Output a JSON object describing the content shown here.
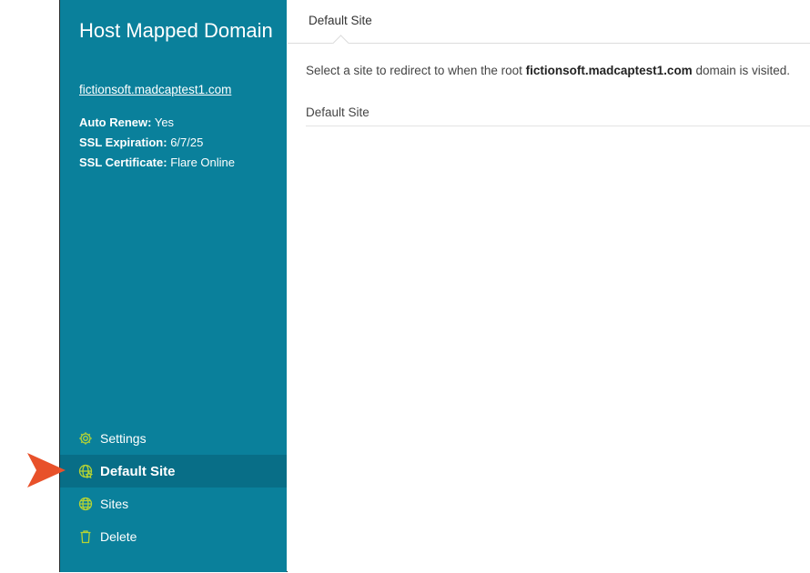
{
  "sidebar": {
    "title": "Host Mapped Domain",
    "domain_link": "fictionsoft.madcaptest1.com",
    "meta": [
      {
        "key": "Auto Renew:",
        "value": "Yes"
      },
      {
        "key": "SSL Expiration:",
        "value": "6/7/25"
      },
      {
        "key": "SSL Certificate:",
        "value": "Flare Online"
      }
    ],
    "nav": [
      {
        "label": "Settings",
        "icon": "gear-icon",
        "active": false
      },
      {
        "label": "Default Site",
        "icon": "globe-star-icon",
        "active": true
      },
      {
        "label": "Sites",
        "icon": "globe-icon",
        "active": false
      },
      {
        "label": "Delete",
        "icon": "trash-icon",
        "active": false
      }
    ]
  },
  "main": {
    "tab_label": "Default Site",
    "description_prefix": "Select a site to redirect to when the root",
    "description_domain": "fictionsoft.madcaptest1.com",
    "description_suffix": "domain is visited.",
    "field_label": "Default Site"
  },
  "colors": {
    "sidebar_bg": "#0a809b",
    "active_bg": "#086e87",
    "icon_green": "#b5d334",
    "pointer_orange": "#e8512a"
  }
}
